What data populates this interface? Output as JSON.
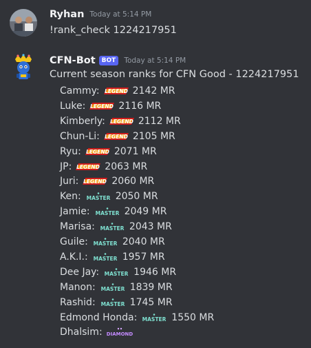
{
  "colors": {
    "background": "#313338",
    "username": "#f2f3f5",
    "text": "#dbdee1",
    "timestamp": "#949ba4",
    "bot_tag": "#5865f2"
  },
  "messages": [
    {
      "author": "Ryhan",
      "timestamp": "Today at 5:14 PM",
      "avatar_icon": "user-avatar-photo",
      "text": "!rank_check 1224217951"
    },
    {
      "author": "CFN-Bot",
      "bot_tag": "BOT",
      "timestamp": "Today at 5:14 PM",
      "avatar_icon": "bot-avatar",
      "text": "Current season ranks for CFN Good - 1224217951",
      "ranks": [
        {
          "character": "Cammy:",
          "rank_icon": "legend-rank-icon",
          "mr": "2142 MR"
        },
        {
          "character": "Luke:",
          "rank_icon": "legend-rank-icon",
          "mr": "2116 MR"
        },
        {
          "character": "Kimberly:",
          "rank_icon": "legend-rank-icon",
          "mr": "2112 MR"
        },
        {
          "character": "Chun-Li:",
          "rank_icon": "legend-rank-icon",
          "mr": "2105 MR"
        },
        {
          "character": "Ryu:",
          "rank_icon": "legend-rank-icon",
          "mr": "2071 MR"
        },
        {
          "character": "JP:",
          "rank_icon": "legend-rank-icon",
          "mr": "2063 MR"
        },
        {
          "character": "Juri:",
          "rank_icon": "legend-rank-icon",
          "mr": "2060 MR"
        },
        {
          "character": "Ken:",
          "rank_icon": "master-rank-icon",
          "mr": "2050 MR"
        },
        {
          "character": "Jamie:",
          "rank_icon": "master-rank-icon",
          "mr": "2049 MR"
        },
        {
          "character": "Marisa:",
          "rank_icon": "master-rank-icon",
          "mr": "2043 MR"
        },
        {
          "character": "Guile:",
          "rank_icon": "master-rank-icon",
          "mr": "2040 MR"
        },
        {
          "character": "A.K.I.:",
          "rank_icon": "master-rank-icon",
          "mr": "1957 MR"
        },
        {
          "character": "Dee Jay:",
          "rank_icon": "master-rank-icon",
          "mr": "1946 MR"
        },
        {
          "character": "Manon:",
          "rank_icon": "master-rank-icon",
          "mr": "1839 MR"
        },
        {
          "character": "Rashid:",
          "rank_icon": "master-rank-icon",
          "mr": "1745 MR"
        },
        {
          "character": "Edmond Honda:",
          "rank_icon": "master-rank-icon",
          "mr": "1550 MR"
        },
        {
          "character": "Dhalsim:",
          "rank_icon": "diamond-rank-icon",
          "mr": ""
        }
      ]
    }
  ],
  "emoji_text": {
    "legend": "LEGEND",
    "master": "MASTER",
    "diamond": "DIAMOND"
  }
}
